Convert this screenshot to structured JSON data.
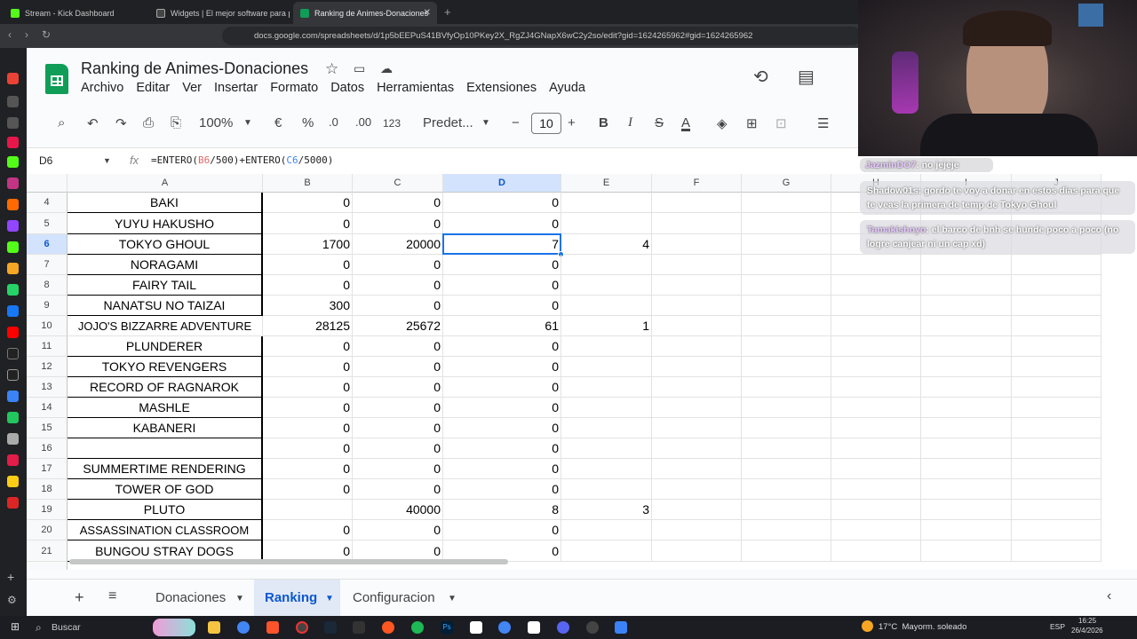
{
  "browser": {
    "tabs": [
      {
        "title": "Stream - Kick Dashboard",
        "color": "#53fc18"
      },
      {
        "title": "Widgets | El mejor software para pot",
        "color": "#333333"
      },
      {
        "title": "Ranking de Animes-Donaciones",
        "color": "#0f9d58"
      }
    ],
    "url": "docs.google.com/spreadsheets/d/1p5bEEPuS41BVfyOp10PKey2X_RgZJ4GNapX6wC2y2so/edit?gid=1624265962#gid=1624265962"
  },
  "doc": {
    "title": "Ranking de Animes-Donaciones",
    "menus": [
      "Archivo",
      "Editar",
      "Ver",
      "Insertar",
      "Formato",
      "Datos",
      "Herramientas",
      "Extensiones",
      "Ayuda"
    ]
  },
  "toolbar": {
    "zoom": "100%",
    "currency": "€",
    "percent": "%",
    "dec_less": ".0",
    "dec_more": ".00",
    "num_format": "123",
    "font": "Predet...",
    "font_size": "10"
  },
  "formula_bar": {
    "cell_ref": "D6",
    "fx": "fx",
    "f_prefix": "=ENTERO(",
    "ref_b": "B6",
    "f_mid1": "/500)+ENTERO(",
    "ref_c": "C6",
    "f_suffix": "/5000)"
  },
  "columns": [
    "A",
    "B",
    "C",
    "D",
    "E",
    "F",
    "G",
    "H",
    "I",
    "J"
  ],
  "rows": [
    {
      "n": "4",
      "a": "BAKI",
      "b": "0",
      "c": "0",
      "d": "0",
      "e": ""
    },
    {
      "n": "5",
      "a": "YUYU HAKUSHO",
      "b": "0",
      "c": "0",
      "d": "0",
      "e": ""
    },
    {
      "n": "6",
      "a": "TOKYO GHOUL",
      "b": "1700",
      "c": "20000",
      "d": "7",
      "e": "4"
    },
    {
      "n": "7",
      "a": "NORAGAMI",
      "b": "0",
      "c": "0",
      "d": "0",
      "e": ""
    },
    {
      "n": "8",
      "a": "FAIRY TAIL",
      "b": "0",
      "c": "0",
      "d": "0",
      "e": ""
    },
    {
      "n": "9",
      "a": "NANATSU NO TAIZAI",
      "b": "300",
      "c": "0",
      "d": "0",
      "e": ""
    },
    {
      "n": "10",
      "a": "JOJO'S BIZZARRE ADVENTURE",
      "b": "28125",
      "c": "25672",
      "d": "61",
      "e": "1"
    },
    {
      "n": "11",
      "a": "PLUNDERER",
      "b": "0",
      "c": "0",
      "d": "0",
      "e": ""
    },
    {
      "n": "12",
      "a": "TOKYO REVENGERS",
      "b": "0",
      "c": "0",
      "d": "0",
      "e": ""
    },
    {
      "n": "13",
      "a": "RECORD OF RAGNAROK",
      "b": "0",
      "c": "0",
      "d": "0",
      "e": ""
    },
    {
      "n": "14",
      "a": "MASHLE",
      "b": "0",
      "c": "0",
      "d": "0",
      "e": ""
    },
    {
      "n": "15",
      "a": "KABANERI",
      "b": "0",
      "c": "0",
      "d": "0",
      "e": ""
    },
    {
      "n": "16",
      "a": "",
      "b": "0",
      "c": "0",
      "d": "0",
      "e": ""
    },
    {
      "n": "17",
      "a": "SUMMERTIME RENDERING",
      "b": "0",
      "c": "0",
      "d": "0",
      "e": ""
    },
    {
      "n": "18",
      "a": "TOWER OF GOD",
      "b": "0",
      "c": "0",
      "d": "0",
      "e": ""
    },
    {
      "n": "19",
      "a": "PLUTO",
      "b": "",
      "c": "40000",
      "d": "8",
      "e": "3"
    },
    {
      "n": "20",
      "a": "ASSASSINATION CLASSROOM",
      "b": "0",
      "c": "0",
      "d": "0",
      "e": ""
    },
    {
      "n": "21",
      "a": "BUNGOU STRAY DOGS",
      "b": "0",
      "c": "0",
      "d": "0",
      "e": ""
    }
  ],
  "sheet_tabs": [
    "Donaciones",
    "Ranking",
    "Configuracion"
  ],
  "chat": [
    {
      "user": "JazminDO7",
      "text": ": no jejeje"
    },
    {
      "user": "Shadow01s",
      "text": ": gordo te voy a donar en estos dias para que te veas la primera de temp de Tokyo Ghoul"
    },
    {
      "user": "Tamakishoyo",
      "text": ": el barco de bnh se hunde poco a poco (no logre canjear ni un cap xd)"
    }
  ],
  "taskbar": {
    "search": "Buscar",
    "weather": "17°C  Mayorm. soleado",
    "lang": "ESP",
    "time": "16:25",
    "date": "26/4/2026"
  }
}
